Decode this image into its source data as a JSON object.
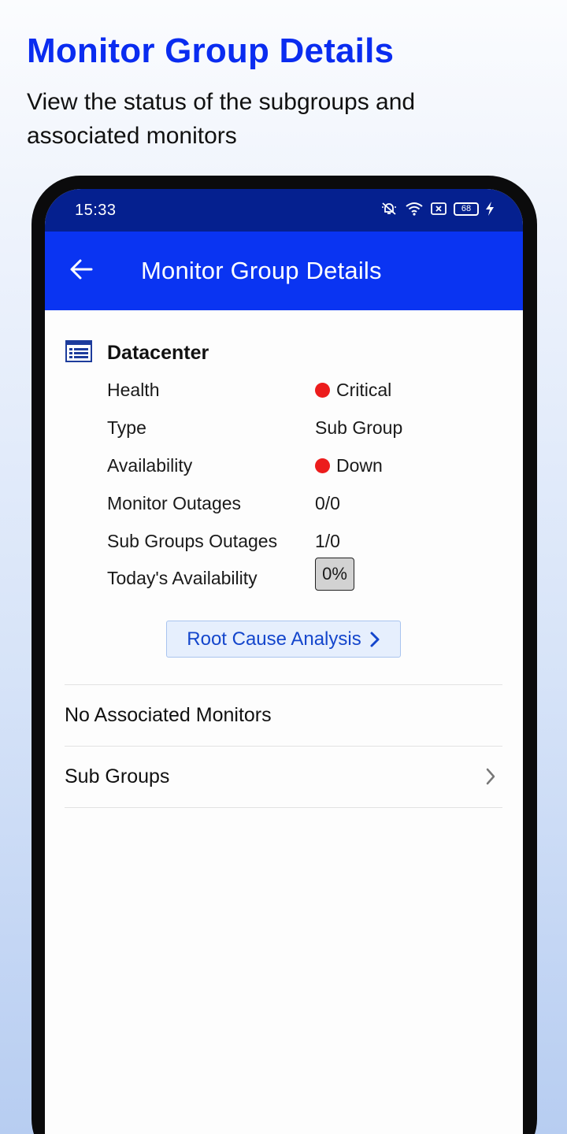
{
  "promo": {
    "title": "Monitor Group Details",
    "subtitle": "View the status of the subgroups and associated monitors"
  },
  "status_bar": {
    "time": "15:33",
    "battery": "68",
    "icons": [
      "bell-off-icon",
      "wifi-icon",
      "sim-off-icon",
      "battery-icon",
      "charging-bolt-icon"
    ]
  },
  "app_bar": {
    "title": "Monitor Group Details",
    "back_icon": "arrow-left-icon"
  },
  "group": {
    "icon": "list-table-icon",
    "name": "Datacenter",
    "details": [
      {
        "label": "Health",
        "value": "Critical",
        "status_color": "#ec1c1c"
      },
      {
        "label": "Type",
        "value": "Sub Group"
      },
      {
        "label": "Availability",
        "value": "Down",
        "status_color": "#ec1c1c"
      },
      {
        "label": "Monitor Outages",
        "value": "0/0"
      },
      {
        "label": "Sub Groups Outages",
        "value": "1/0"
      },
      {
        "label": "Today's Availability",
        "value": "0%"
      }
    ]
  },
  "actions": {
    "root_cause_label": "Root Cause Analysis"
  },
  "list": {
    "no_monitors": "No Associated Monitors",
    "sub_groups": "Sub Groups"
  },
  "colors": {
    "accent": "#0a34f2",
    "status_bar": "#05208f",
    "promo_title": "#0a2cf0",
    "critical": "#ec1c1c"
  }
}
